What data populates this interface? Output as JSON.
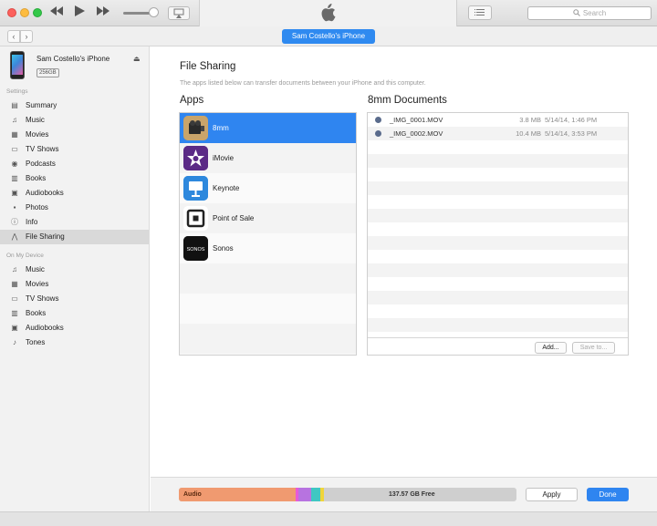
{
  "window": {
    "search_placeholder": "Search",
    "device_tab_label": "Sam Costello's iPhone"
  },
  "device": {
    "name": "Sam Costello's iPhone",
    "capacity": "256GB"
  },
  "sidebar": {
    "settings_heading": "Settings",
    "settings_items": [
      {
        "label": "Summary",
        "icon": "summary-icon",
        "glyph": "▤"
      },
      {
        "label": "Music",
        "icon": "music-icon",
        "glyph": "♫"
      },
      {
        "label": "Movies",
        "icon": "movies-icon",
        "glyph": "▦"
      },
      {
        "label": "TV Shows",
        "icon": "tv-icon",
        "glyph": "▭"
      },
      {
        "label": "Podcasts",
        "icon": "podcasts-icon",
        "glyph": "◉"
      },
      {
        "label": "Books",
        "icon": "books-icon",
        "glyph": "▥"
      },
      {
        "label": "Audiobooks",
        "icon": "audiobooks-icon",
        "glyph": "▣"
      },
      {
        "label": "Photos",
        "icon": "photos-icon",
        "glyph": "▪"
      },
      {
        "label": "Info",
        "icon": "info-icon",
        "glyph": "ⓘ"
      },
      {
        "label": "File Sharing",
        "icon": "file-sharing-icon",
        "glyph": "⋀"
      }
    ],
    "selected": "File Sharing",
    "on_device_heading": "On My Device",
    "device_items": [
      {
        "label": "Music",
        "icon": "music-icon",
        "glyph": "♫"
      },
      {
        "label": "Movies",
        "icon": "movies-icon",
        "glyph": "▦"
      },
      {
        "label": "TV Shows",
        "icon": "tv-icon",
        "glyph": "▭"
      },
      {
        "label": "Books",
        "icon": "books-icon",
        "glyph": "▥"
      },
      {
        "label": "Audiobooks",
        "icon": "audiobooks-icon",
        "glyph": "▣"
      },
      {
        "label": "Tones",
        "icon": "bell-icon",
        "glyph": "♪"
      }
    ]
  },
  "main": {
    "title": "File Sharing",
    "description": "The apps listed below can transfer documents between your iPhone and this computer.",
    "apps_heading": "Apps",
    "apps": [
      {
        "name": "8mm",
        "icon": "8mm-app-icon",
        "color": "#b58a4a",
        "selected": true
      },
      {
        "name": "iMovie",
        "icon": "imovie-app-icon",
        "color": "#5b2a86"
      },
      {
        "name": "Keynote",
        "icon": "keynote-app-icon",
        "color": "#2d88dd"
      },
      {
        "name": "Point of Sale",
        "icon": "point-of-sale-app-icon",
        "color": "#ffffff"
      },
      {
        "name": "Sonos",
        "icon": "sonos-app-icon",
        "color": "#111111",
        "icon_text": "SONOS"
      }
    ],
    "documents_heading": "8mm Documents",
    "documents": [
      {
        "name": "_IMG_0001.MOV",
        "size": "3.8 MB",
        "date": "5/14/14, 1:46 PM"
      },
      {
        "name": "_IMG_0002.MOV",
        "size": "10.4 MB",
        "date": "5/14/14, 3:53 PM"
      }
    ],
    "add_label": "Add...",
    "save_to_label": "Save to..."
  },
  "storage": {
    "audio_label": "Audio",
    "free_label": "137.57 GB Free",
    "apply_label": "Apply",
    "done_label": "Done",
    "colors": {
      "audio": "#f09a70",
      "pink": "#e85ad8",
      "purple": "#b773e0",
      "teal": "#3fc7c2",
      "yellow": "#f0d53a",
      "free": "#cfcfcf",
      "accent": "#2f85f0"
    }
  }
}
